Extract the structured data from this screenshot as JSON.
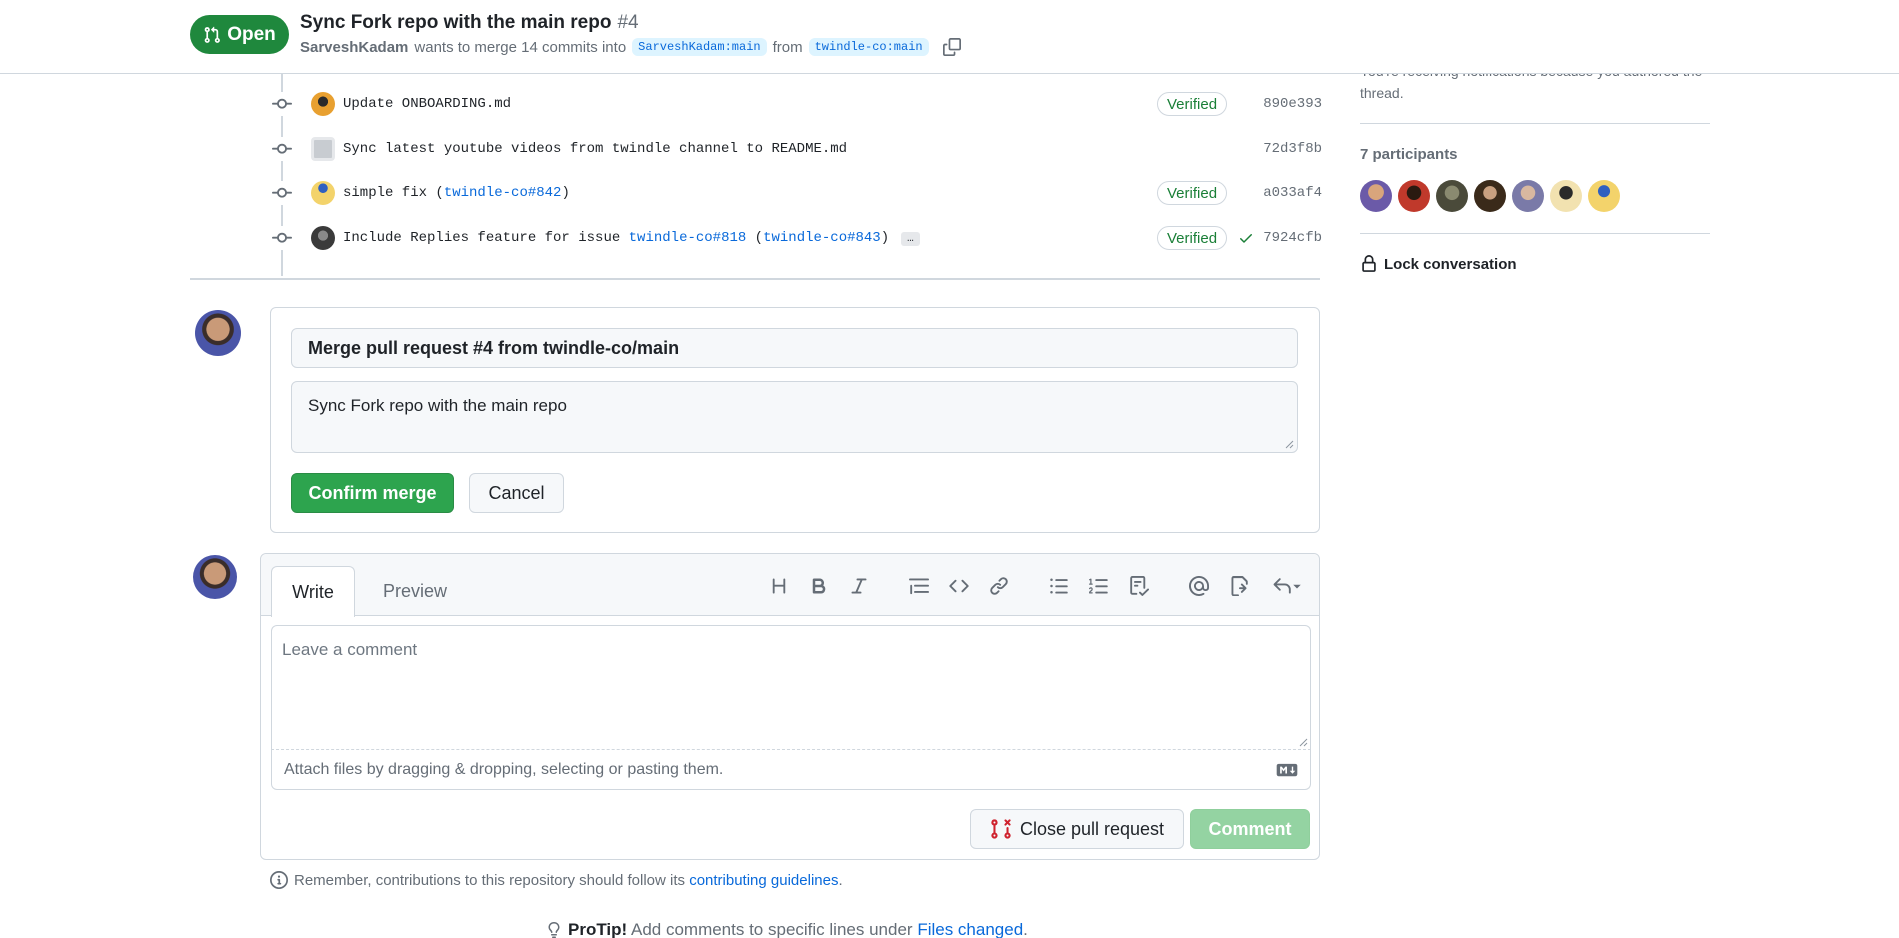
{
  "header": {
    "state": "Open",
    "title": "Sync Fork repo with the main repo",
    "number": "#4",
    "author": "SarveshKadam",
    "merge_text": "wants to merge 14 commits into",
    "base_branch": "SarveshKadam:main",
    "from_text": "from",
    "head_branch": "twindle-co:main"
  },
  "commits": [
    {
      "message": "Update ONBOARDING.md",
      "verified": "Verified",
      "sha": "890e393",
      "avatar_color": "#e8a030"
    },
    {
      "message": "Sync latest youtube videos from twindle channel to README.md",
      "verified": "",
      "sha": "72d3f8b",
      "avatar_color": "#c8ccd1"
    },
    {
      "message_prefix": "simple fix (",
      "link1": "twindle-co#842",
      "message_suffix": ")",
      "verified": "Verified",
      "sha": "a033af4",
      "avatar_color": "#f3d36b"
    },
    {
      "message_prefix": "Include Replies feature for issue ",
      "link1": "twindle-co#818",
      "middle": " (",
      "link2": "twindle-co#843",
      "message_suffix": ")",
      "ellipsis": "…",
      "verified": "Verified",
      "sha": "7924cfb",
      "avatar_color": "#3a3a3a"
    }
  ],
  "merge_box": {
    "title_value": "Merge pull request #4 from twindle-co/main",
    "body_value": "Sync Fork repo with the main repo",
    "confirm_label": "Confirm merge",
    "cancel_label": "Cancel"
  },
  "composer": {
    "tab_write": "Write",
    "tab_preview": "Preview",
    "placeholder": "Leave a comment",
    "attach_text": "Attach files by dragging & dropping, selecting or pasting them.",
    "close_pr_label": "Close pull request",
    "comment_label": "Comment",
    "toolbar_icons": [
      "heading-icon",
      "bold-icon",
      "italic-icon",
      "quote-icon",
      "code-icon",
      "link-icon",
      "unordered-list-icon",
      "ordered-list-icon",
      "task-list-icon",
      "mention-icon",
      "cross-reference-icon",
      "saved-replies-icon"
    ]
  },
  "notice": {
    "text": "Remember, contributions to this repository should follow its",
    "link": "contributing guidelines",
    "end": "."
  },
  "protip": {
    "bold": "ProTip!",
    "text": "Add comments to specific lines under",
    "link": "Files changed",
    "end": "."
  },
  "sidebar": {
    "notification_text": "You're receiving notifications because you authored the thread.",
    "participants_title": "7 participants",
    "participant_colors": [
      "#6b5aa8",
      "#c0392b",
      "#4a4a3a",
      "#3a2a1a",
      "#7a7aa8",
      "#e8a030",
      "#f3d36b"
    ],
    "lock_label": "Lock conversation"
  },
  "colors": {
    "accent_green": "#1f883d",
    "link_blue": "#0969da",
    "verified_green": "#1a7f37"
  }
}
